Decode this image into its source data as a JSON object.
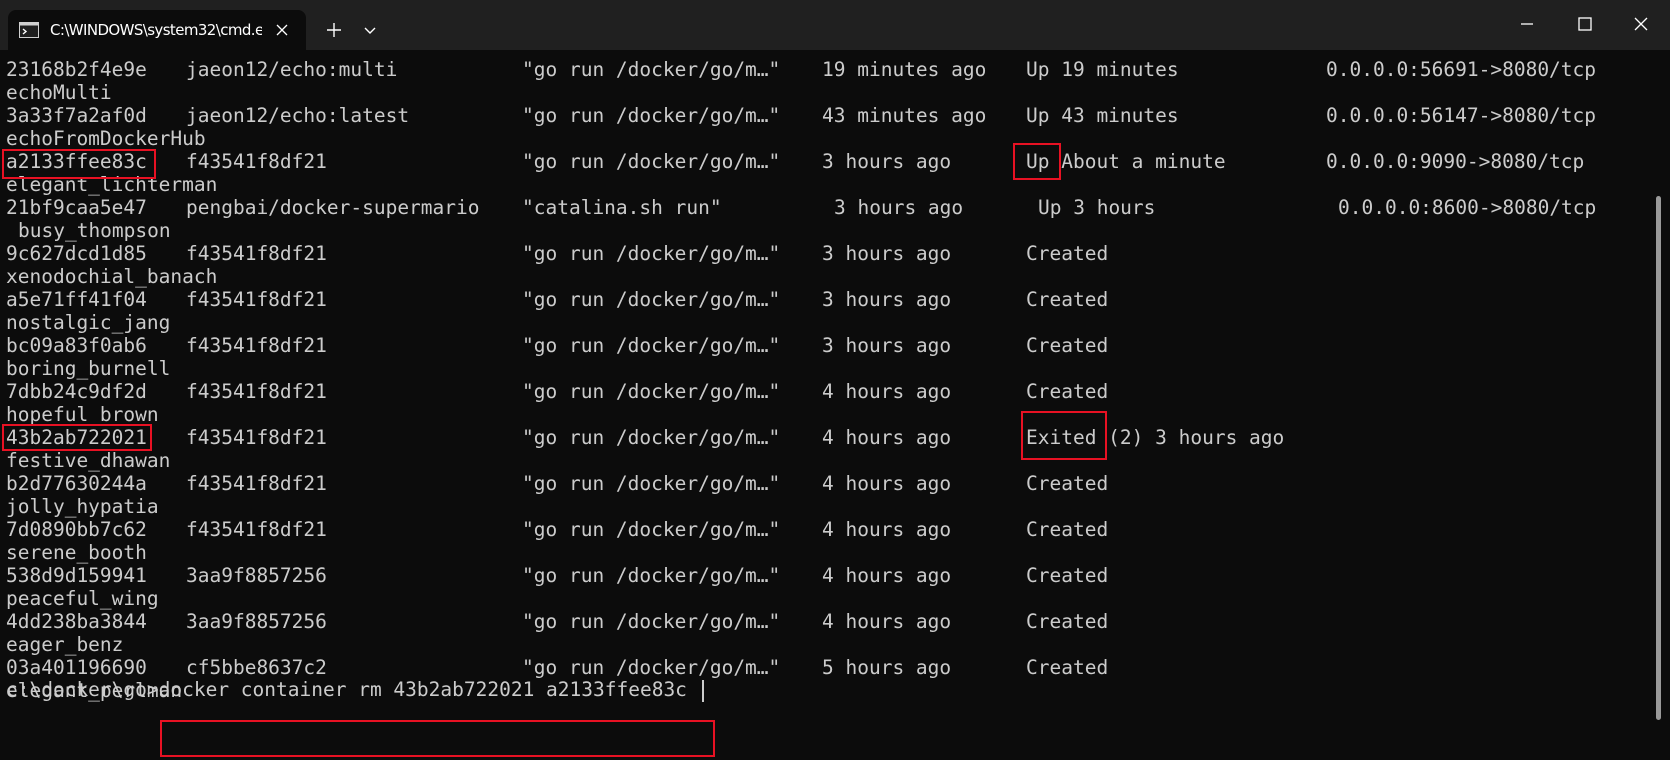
{
  "window": {
    "tab_title": "C:\\WINDOWS\\system32\\cmd.exe",
    "icons": {
      "tab": "terminal-icon",
      "close_tab": "close-icon",
      "new_tab": "plus-icon",
      "dropdown": "chevron-down-icon",
      "minimize": "minimize-icon",
      "maximize": "maximize-icon",
      "close": "close-icon"
    }
  },
  "containers": [
    {
      "id": "23168b2f4e9e",
      "image": "jaeon12/echo:multi",
      "command": "\"go run /docker/go/m…\"",
      "created": "19 minutes ago",
      "status": "Up 19 minutes",
      "ports": "0.0.0.0:56691->8080/tcp",
      "name": "echoMulti"
    },
    {
      "id": "3a33f7a2af0d",
      "image": "jaeon12/echo:latest",
      "command": "\"go run /docker/go/m…\"",
      "created": "43 minutes ago",
      "status": "Up 43 minutes",
      "ports": "0.0.0.0:56147->8080/tcp",
      "name": "echoFromDockerHub"
    },
    {
      "id": "a2133ffee83c",
      "image": "f43541f8df21",
      "command": "\"go run /docker/go/m…\"",
      "created": "3 hours ago",
      "status": "Up About a minute",
      "ports": "0.0.0.0:9090->8080/tcp",
      "name": "elegant_lichterman"
    },
    {
      "id": "21bf9caa5e47",
      "image": "pengbai/docker-supermario",
      "command": "\"catalina.sh run\"",
      "created": "3 hours ago",
      "status": "Up 3 hours",
      "ports": "0.0.0.0:8600->8080/tcp",
      "name": "busy_thompson"
    },
    {
      "id": "9c627dcd1d85",
      "image": "f43541f8df21",
      "command": "\"go run /docker/go/m…\"",
      "created": "3 hours ago",
      "status": "Created",
      "ports": "",
      "name": "xenodochial_banach"
    },
    {
      "id": "a5e71ff41f04",
      "image": "f43541f8df21",
      "command": "\"go run /docker/go/m…\"",
      "created": "3 hours ago",
      "status": "Created",
      "ports": "",
      "name": "nostalgic_jang"
    },
    {
      "id": "bc09a83f0ab6",
      "image": "f43541f8df21",
      "command": "\"go run /docker/go/m…\"",
      "created": "3 hours ago",
      "status": "Created",
      "ports": "",
      "name": "boring_burnell"
    },
    {
      "id": "7dbb24c9df2d",
      "image": "f43541f8df21",
      "command": "\"go run /docker/go/m…\"",
      "created": "4 hours ago",
      "status": "Created",
      "ports": "",
      "name": "hopeful_brown"
    },
    {
      "id": "43b2ab722021",
      "image": "f43541f8df21",
      "command": "\"go run /docker/go/m…\"",
      "created": "4 hours ago",
      "status": "Exited (2) 3 hours ago",
      "ports": "",
      "name": "festive_dhawan"
    },
    {
      "id": "b2d77630244a",
      "image": "f43541f8df21",
      "command": "\"go run /docker/go/m…\"",
      "created": "4 hours ago",
      "status": "Created",
      "ports": "",
      "name": "jolly_hypatia"
    },
    {
      "id": "7d0890bb7c62",
      "image": "f43541f8df21",
      "command": "\"go run /docker/go/m…\"",
      "created": "4 hours ago",
      "status": "Created",
      "ports": "",
      "name": "serene_booth"
    },
    {
      "id": "538d9d159941",
      "image": "3aa9f8857256",
      "command": "\"go run /docker/go/m…\"",
      "created": "4 hours ago",
      "status": "Created",
      "ports": "",
      "name": "peaceful_wing"
    },
    {
      "id": "4dd238ba3844",
      "image": "3aa9f8857256",
      "command": "\"go run /docker/go/m…\"",
      "created": "4 hours ago",
      "status": "Created",
      "ports": "",
      "name": "eager_benz"
    },
    {
      "id": "03a401196690",
      "image": "cf5bbe8637c2",
      "command": "\"go run /docker/go/m…\"",
      "created": "5 hours ago",
      "status": "Created",
      "ports": "",
      "name": "elegant_perlman"
    }
  ],
  "prompt": {
    "path": "c:\\docker\\go>",
    "command": "docker container rm 43b2ab722021 a2133ffee83c"
  },
  "colors": {
    "highlight": "#e81123",
    "background": "#0c0c0c",
    "titlebar": "#202020",
    "text": "#cccccc"
  }
}
